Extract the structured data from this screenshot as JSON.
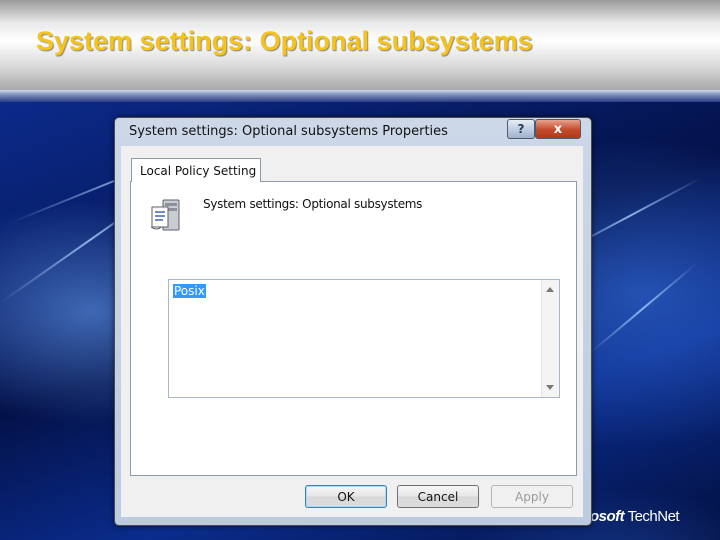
{
  "slide": {
    "title": "System settings: Optional subsystems",
    "brand_prefix": "osoft",
    "brand_suffix": " TechNet"
  },
  "dialog": {
    "title": "System settings: Optional subsystems Properties",
    "help_button": "?",
    "close_button": "x",
    "tabs": [
      {
        "label": "Local Policy Setting",
        "selected": true
      }
    ],
    "policy_name": "System settings: Optional subsystems",
    "policy_icon": "policy-server-icon",
    "text_value": "Posix",
    "buttons": {
      "ok": "OK",
      "cancel": "Cancel",
      "apply": "Apply"
    }
  },
  "colors": {
    "title_gold": "#f6c21c",
    "selection_blue": "#3399ff",
    "close_red": "#c24a2b"
  }
}
